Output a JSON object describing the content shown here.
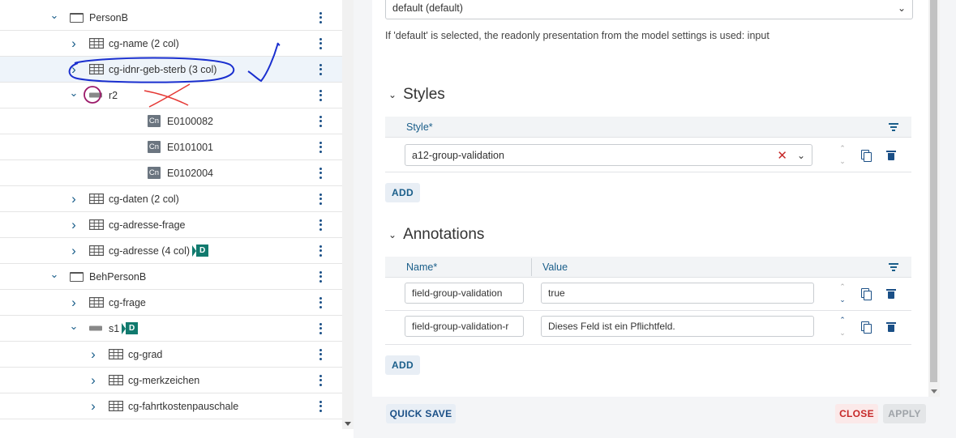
{
  "tree": {
    "rows": [
      {
        "label": "PersonB",
        "chevron": "down",
        "icon": "group",
        "badge": ""
      },
      {
        "label": "cg-name (2 col)",
        "chevron": "right",
        "icon": "table",
        "badge": ""
      },
      {
        "label": "cg-idnr-geb-sterb (3 col)",
        "chevron": "right",
        "icon": "table",
        "badge": "",
        "selected": true
      },
      {
        "label": "r2",
        "chevron": "down",
        "icon": "row",
        "badge": ""
      },
      {
        "label": "E0100082",
        "chevron": "",
        "icon": "Cn",
        "badge": ""
      },
      {
        "label": "E0101001",
        "chevron": "",
        "icon": "Cn",
        "badge": ""
      },
      {
        "label": "E0102004",
        "chevron": "",
        "icon": "Cn",
        "badge": ""
      },
      {
        "label": "cg-daten (2 col)",
        "chevron": "right",
        "icon": "table",
        "badge": ""
      },
      {
        "label": "cg-adresse-frage",
        "chevron": "right",
        "icon": "table",
        "badge": ""
      },
      {
        "label": "cg-adresse (4 col)",
        "chevron": "right",
        "icon": "table",
        "badge": "D"
      },
      {
        "label": "BehPersonB",
        "chevron": "down",
        "icon": "group",
        "badge": ""
      },
      {
        "label": "cg-frage",
        "chevron": "right",
        "icon": "table",
        "badge": ""
      },
      {
        "label": "s1",
        "chevron": "down",
        "icon": "row",
        "badge": "D"
      },
      {
        "label": "cg-grad",
        "chevron": "right",
        "icon": "table",
        "badge": ""
      },
      {
        "label": "cg-merkzeichen",
        "chevron": "right",
        "icon": "table",
        "badge": ""
      },
      {
        "label": "cg-fahrtkostenpauschale",
        "chevron": "right",
        "icon": "table",
        "badge": ""
      }
    ]
  },
  "dialog": {
    "presentation_select": "default (default)",
    "presentation_hint": "If 'default' is selected, the readonly presentation from the model settings is used: input",
    "styles": {
      "title": "Styles",
      "header": "Style*",
      "rows": [
        {
          "value": "a12-group-validation"
        }
      ],
      "add_label": "ADD"
    },
    "annotations": {
      "title": "Annotations",
      "header_name": "Name*",
      "header_value": "Value",
      "rows": [
        {
          "name": "field-group-validation",
          "value": "true"
        },
        {
          "name": "field-group-validation-r",
          "value": "Dieses Feld ist ein Pflichtfeld."
        }
      ],
      "add_label": "ADD"
    },
    "footer": {
      "quick_save": "QUICK SAVE",
      "close": "CLOSE",
      "apply": "APPLY"
    }
  },
  "colors": {
    "accent": "#1a5e8a",
    "badge": "#117a6e",
    "danger": "#c62828",
    "annotation_blue": "#1a2fcf",
    "annotation_red": "#e53935",
    "annotation_purple": "#9c1a6a"
  },
  "icons": [
    "chevron-down-icon",
    "chevron-right-icon",
    "group-icon",
    "table-icon",
    "row-icon",
    "kebab-menu-icon",
    "clear-icon",
    "copy-icon",
    "trash-icon",
    "filter-icon",
    "sort-up-icon",
    "sort-down-icon"
  ]
}
